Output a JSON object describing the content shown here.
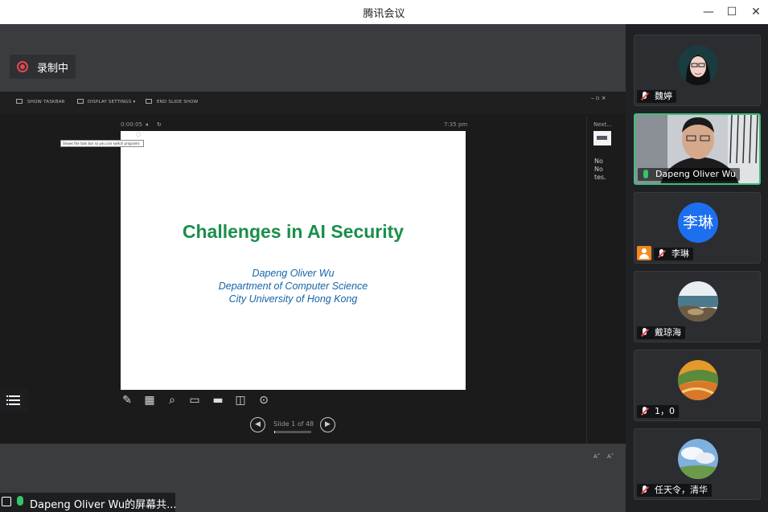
{
  "window": {
    "title": "腾讯会议",
    "minimize": "—",
    "maximize": "☐",
    "close": "✕"
  },
  "recording": {
    "label": "录制中"
  },
  "presenter_toolbar": {
    "show_taskbar": "SHOW TASKBAR",
    "display_settings": "DISPLAY SETTINGS ▾",
    "end_slide_show": "END SLIDE SHOW",
    "window_controls": "–  ▫  ×"
  },
  "presenter": {
    "timer": "0:00:05",
    "pause_icon": "⏸",
    "reset_icon": "↻",
    "clock": "7:35 pm",
    "tooltip": "Shows the task bar so you can switch programs",
    "next_label": "Next...",
    "notes_lines": [
      "No",
      "No",
      "tes."
    ],
    "font_increase": "A˄",
    "font_decrease": "A˅",
    "slide_counter": "Slide 1 of 48",
    "slide_progress": 0.02
  },
  "slide": {
    "title": "Challenges in AI Security",
    "author": "Dapeng Oliver Wu",
    "department": "Department of Computer Science",
    "university": "City University of Hong Kong"
  },
  "sharer_bar": {
    "label": "Dapeng Oliver Wu的屏幕共..."
  },
  "participants": [
    {
      "name": "魏婷",
      "muted": true
    },
    {
      "name": "Dapeng Oliver Wu",
      "muted": false,
      "active": true
    },
    {
      "name": "李琳",
      "avatar_text": "李琳",
      "muted": true,
      "host": true
    },
    {
      "name": "戴琼海",
      "muted": true
    },
    {
      "name": "1，0",
      "muted": true
    },
    {
      "name": "任天令，清华",
      "muted": true
    }
  ],
  "colors": {
    "accent_green": "#3cbf7a",
    "record_red": "#e5484d",
    "slide_title": "#1a8f4a",
    "slide_author": "#1565a8",
    "avatar_blue": "#1d6fef",
    "host_orange": "#f08a24"
  }
}
